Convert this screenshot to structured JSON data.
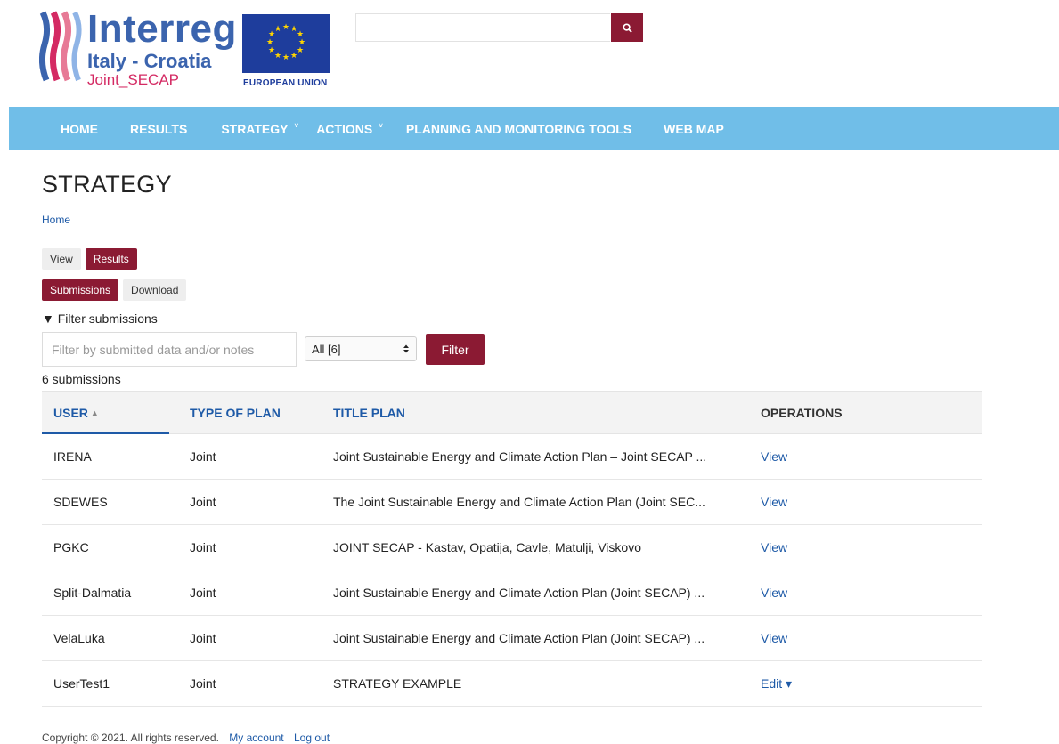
{
  "header": {
    "logo_text_line1": "Interreg",
    "logo_text_line2": "Italy - Croatia",
    "logo_text_line3": "Joint_SECAP",
    "eu_label": "EUROPEAN UNION",
    "search_placeholder": "",
    "search_icon": "search-icon"
  },
  "nav": {
    "items": [
      {
        "label": "HOME",
        "dropdown": false
      },
      {
        "label": "RESULTS",
        "dropdown": false
      },
      {
        "label": "STRATEGY",
        "dropdown": true
      },
      {
        "label": "ACTIONS",
        "dropdown": true
      },
      {
        "label": "PLANNING AND MONITORING TOOLS",
        "dropdown": false
      },
      {
        "label": "WEB MAP",
        "dropdown": false
      }
    ],
    "caret": "˅"
  },
  "page": {
    "title": "STRATEGY",
    "breadcrumb": "Home",
    "tabs_primary": [
      {
        "label": "View",
        "active": false
      },
      {
        "label": "Results",
        "active": true
      }
    ],
    "tabs_secondary": [
      {
        "label": "Submissions",
        "active": true
      },
      {
        "label": "Download",
        "active": false
      }
    ],
    "filter_toggle": "▼ Filter submissions",
    "filter_placeholder": "Filter by submitted data and/or notes",
    "filter_select_value": "All [6]",
    "filter_button": "Filter",
    "count": "6 submissions"
  },
  "table": {
    "columns": [
      "USER",
      "TYPE OF PLAN",
      "TITLE PLAN",
      "OPERATIONS"
    ],
    "sort_indicator": "▲",
    "rows": [
      {
        "user": "IRENA",
        "type": "Joint",
        "title": "Joint Sustainable Energy and Climate Action Plan – Joint SECAP ...",
        "op": "View"
      },
      {
        "user": "SDEWES",
        "type": "Joint",
        "title": "The Joint Sustainable Energy and Climate Action Plan (Joint SEC...",
        "op": "View"
      },
      {
        "user": "PGKC",
        "type": "Joint",
        "title": "JOINT SECAP - Kastav, Opatija, Cavle, Matulji, Viskovo",
        "op": "View"
      },
      {
        "user": "Split-Dalmatia",
        "type": "Joint",
        "title": "Joint Sustainable Energy and Climate Action Plan (Joint SECAP) ...",
        "op": "View"
      },
      {
        "user": "VelaLuka",
        "type": "Joint",
        "title": "Joint Sustainable Energy and Climate Action Plan (Joint SECAP) ...",
        "op": "View"
      },
      {
        "user": "UserTest1",
        "type": "Joint",
        "title": "STRATEGY EXAMPLE",
        "op": "Edit ▾"
      }
    ]
  },
  "footer": {
    "copyright": "Copyright © 2021. All rights reserved.",
    "links": [
      "My account",
      "Log out"
    ]
  },
  "colors": {
    "accent": "#8b1a33",
    "nav_bg": "#70bee8",
    "link": "#1e5aa7",
    "logo_blue": "#3b64ae",
    "logo_pink": "#d42a63"
  }
}
